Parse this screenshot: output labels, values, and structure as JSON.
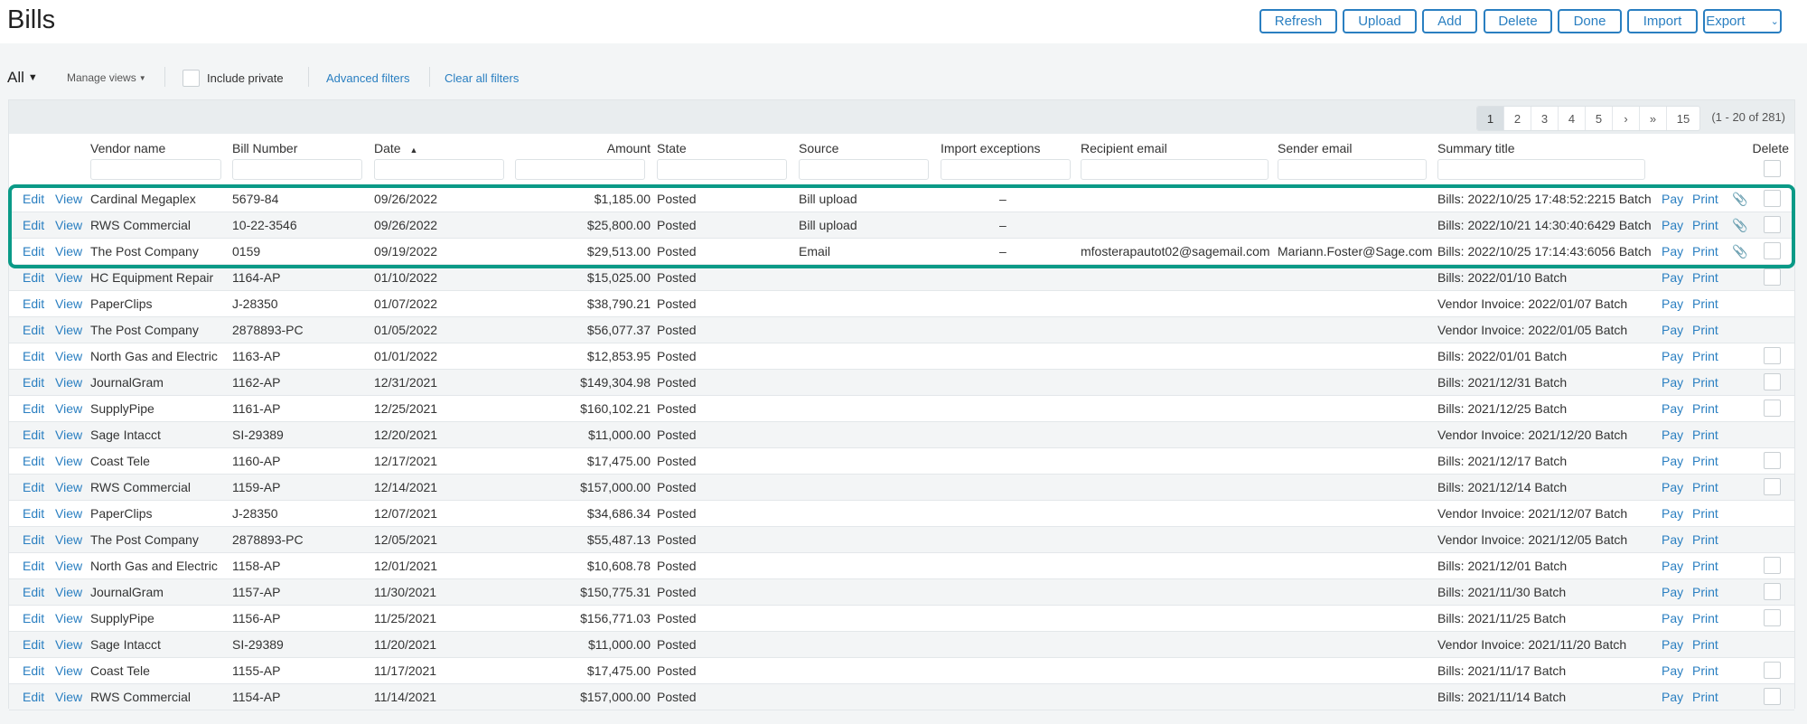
{
  "header": {
    "title": "Bills",
    "buttons": [
      "Refresh",
      "Upload",
      "Add",
      "Delete",
      "Done",
      "Import",
      "Export"
    ]
  },
  "filters": {
    "view": "All",
    "manage_views": "Manage views",
    "include_private": "Include private",
    "advanced_filters": "Advanced filters",
    "clear_all_filters": "Clear all filters"
  },
  "pagination": {
    "pages": [
      "1",
      "2",
      "3",
      "4",
      "5",
      "›",
      "»",
      "15"
    ],
    "current": "1",
    "count_label": "(1 - 20 of 281)"
  },
  "columns": {
    "vendor": "Vendor name",
    "bill": "Bill Number",
    "date": "Date",
    "date_sort": "▲",
    "amount": "Amount",
    "state": "State",
    "source": "Source",
    "import_exceptions": "Import exceptions",
    "recipient": "Recipient email",
    "sender": "Sender email",
    "summary": "Summary title",
    "delete": "Delete"
  },
  "row_actions": {
    "edit": "Edit",
    "view": "View",
    "pay": "Pay",
    "print": "Print"
  },
  "accent_color": "#2a7fc1",
  "highlight_color": "#0a9a87",
  "rows": [
    {
      "vendor": "Cardinal Megaplex",
      "bill": "5679-84",
      "date": "09/26/2022",
      "amount": "$1,185.00",
      "state": "Posted",
      "source": "Bill upload",
      "import_exceptions": "–",
      "recipient": "",
      "sender": "",
      "summary": "Bills: 2022/10/25 17:48:52:2215 Batch",
      "attachment": true,
      "deletable": true
    },
    {
      "vendor": "RWS Commercial",
      "bill": "10-22-3546",
      "date": "09/26/2022",
      "amount": "$25,800.00",
      "state": "Posted",
      "source": "Bill upload",
      "import_exceptions": "–",
      "recipient": "",
      "sender": "",
      "summary": "Bills: 2022/10/21 14:30:40:6429 Batch",
      "attachment": true,
      "deletable": true
    },
    {
      "vendor": "The Post Company",
      "bill": "0159",
      "date": "09/19/2022",
      "amount": "$29,513.00",
      "state": "Posted",
      "source": "Email",
      "import_exceptions": "–",
      "recipient": "mfosterapautot02@sagemail.com",
      "sender": "Mariann.Foster@Sage.com",
      "summary": "Bills: 2022/10/25 17:14:43:6056 Batch",
      "attachment": true,
      "deletable": true
    },
    {
      "vendor": "HC Equipment Repair",
      "bill": "1164-AP",
      "date": "01/10/2022",
      "amount": "$15,025.00",
      "state": "Posted",
      "source": "",
      "import_exceptions": "",
      "recipient": "",
      "sender": "",
      "summary": "Bills: 2022/01/10 Batch",
      "attachment": false,
      "deletable": true
    },
    {
      "vendor": "PaperClips",
      "bill": "J-28350",
      "date": "01/07/2022",
      "amount": "$38,790.21",
      "state": "Posted",
      "source": "",
      "import_exceptions": "",
      "recipient": "",
      "sender": "",
      "summary": "Vendor Invoice: 2022/01/07 Batch",
      "attachment": false,
      "deletable": false
    },
    {
      "vendor": "The Post Company",
      "bill": "2878893-PC",
      "date": "01/05/2022",
      "amount": "$56,077.37",
      "state": "Posted",
      "source": "",
      "import_exceptions": "",
      "recipient": "",
      "sender": "",
      "summary": "Vendor Invoice: 2022/01/05 Batch",
      "attachment": false,
      "deletable": false
    },
    {
      "vendor": "North Gas and Electric",
      "bill": "1163-AP",
      "date": "01/01/2022",
      "amount": "$12,853.95",
      "state": "Posted",
      "source": "",
      "import_exceptions": "",
      "recipient": "",
      "sender": "",
      "summary": "Bills: 2022/01/01 Batch",
      "attachment": false,
      "deletable": true
    },
    {
      "vendor": "JournalGram",
      "bill": "1162-AP",
      "date": "12/31/2021",
      "amount": "$149,304.98",
      "state": "Posted",
      "source": "",
      "import_exceptions": "",
      "recipient": "",
      "sender": "",
      "summary": "Bills: 2021/12/31 Batch",
      "attachment": false,
      "deletable": true
    },
    {
      "vendor": "SupplyPipe",
      "bill": "1161-AP",
      "date": "12/25/2021",
      "amount": "$160,102.21",
      "state": "Posted",
      "source": "",
      "import_exceptions": "",
      "recipient": "",
      "sender": "",
      "summary": "Bills: 2021/12/25 Batch",
      "attachment": false,
      "deletable": true
    },
    {
      "vendor": "Sage Intacct",
      "bill": "SI-29389",
      "date": "12/20/2021",
      "amount": "$11,000.00",
      "state": "Posted",
      "source": "",
      "import_exceptions": "",
      "recipient": "",
      "sender": "",
      "summary": "Vendor Invoice: 2021/12/20 Batch",
      "attachment": false,
      "deletable": false
    },
    {
      "vendor": "Coast Tele",
      "bill": "1160-AP",
      "date": "12/17/2021",
      "amount": "$17,475.00",
      "state": "Posted",
      "source": "",
      "import_exceptions": "",
      "recipient": "",
      "sender": "",
      "summary": "Bills: 2021/12/17 Batch",
      "attachment": false,
      "deletable": true
    },
    {
      "vendor": "RWS Commercial",
      "bill": "1159-AP",
      "date": "12/14/2021",
      "amount": "$157,000.00",
      "state": "Posted",
      "source": "",
      "import_exceptions": "",
      "recipient": "",
      "sender": "",
      "summary": "Bills: 2021/12/14 Batch",
      "attachment": false,
      "deletable": true
    },
    {
      "vendor": "PaperClips",
      "bill": "J-28350",
      "date": "12/07/2021",
      "amount": "$34,686.34",
      "state": "Posted",
      "source": "",
      "import_exceptions": "",
      "recipient": "",
      "sender": "",
      "summary": "Vendor Invoice: 2021/12/07 Batch",
      "attachment": false,
      "deletable": false
    },
    {
      "vendor": "The Post Company",
      "bill": "2878893-PC",
      "date": "12/05/2021",
      "amount": "$55,487.13",
      "state": "Posted",
      "source": "",
      "import_exceptions": "",
      "recipient": "",
      "sender": "",
      "summary": "Vendor Invoice: 2021/12/05 Batch",
      "attachment": false,
      "deletable": false
    },
    {
      "vendor": "North Gas and Electric",
      "bill": "1158-AP",
      "date": "12/01/2021",
      "amount": "$10,608.78",
      "state": "Posted",
      "source": "",
      "import_exceptions": "",
      "recipient": "",
      "sender": "",
      "summary": "Bills: 2021/12/01 Batch",
      "attachment": false,
      "deletable": true
    },
    {
      "vendor": "JournalGram",
      "bill": "1157-AP",
      "date": "11/30/2021",
      "amount": "$150,775.31",
      "state": "Posted",
      "source": "",
      "import_exceptions": "",
      "recipient": "",
      "sender": "",
      "summary": "Bills: 2021/11/30 Batch",
      "attachment": false,
      "deletable": true
    },
    {
      "vendor": "SupplyPipe",
      "bill": "1156-AP",
      "date": "11/25/2021",
      "amount": "$156,771.03",
      "state": "Posted",
      "source": "",
      "import_exceptions": "",
      "recipient": "",
      "sender": "",
      "summary": "Bills: 2021/11/25 Batch",
      "attachment": false,
      "deletable": true
    },
    {
      "vendor": "Sage Intacct",
      "bill": "SI-29389",
      "date": "11/20/2021",
      "amount": "$11,000.00",
      "state": "Posted",
      "source": "",
      "import_exceptions": "",
      "recipient": "",
      "sender": "",
      "summary": "Vendor Invoice: 2021/11/20 Batch",
      "attachment": false,
      "deletable": false
    },
    {
      "vendor": "Coast Tele",
      "bill": "1155-AP",
      "date": "11/17/2021",
      "amount": "$17,475.00",
      "state": "Posted",
      "source": "",
      "import_exceptions": "",
      "recipient": "",
      "sender": "",
      "summary": "Bills: 2021/11/17 Batch",
      "attachment": false,
      "deletable": true
    },
    {
      "vendor": "RWS Commercial",
      "bill": "1154-AP",
      "date": "11/14/2021",
      "amount": "$157,000.00",
      "state": "Posted",
      "source": "",
      "import_exceptions": "",
      "recipient": "",
      "sender": "",
      "summary": "Bills: 2021/11/14 Batch",
      "attachment": false,
      "deletable": true
    }
  ]
}
